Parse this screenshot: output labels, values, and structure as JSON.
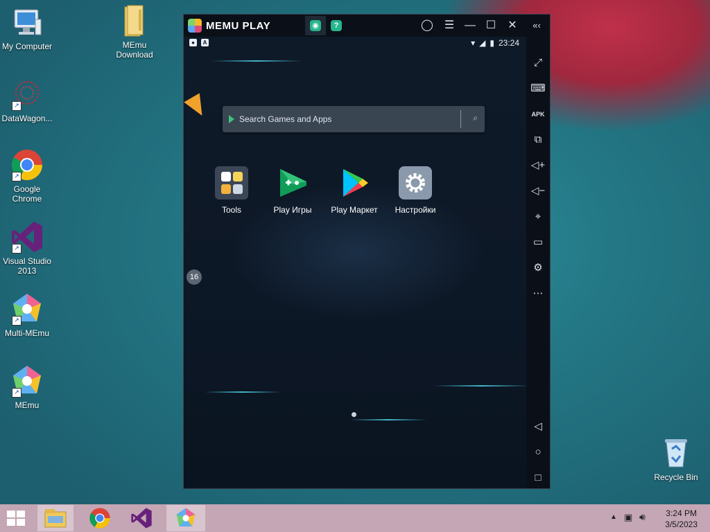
{
  "desktop": {
    "icons": [
      {
        "label": "My Computer",
        "icon": "computer-icon"
      },
      {
        "label": "MEmu\nDownload",
        "icon": "folder-icon"
      },
      {
        "label": "DataWagon...",
        "icon": "datawagon-icon"
      },
      {
        "label": "Google\nChrome",
        "icon": "chrome-icon"
      },
      {
        "label": "Visual Studio\n2013",
        "icon": "visual-studio-icon"
      },
      {
        "label": "Multi-MEmu",
        "icon": "multi-memu-icon"
      },
      {
        "label": "MEmu",
        "icon": "memu-icon"
      },
      {
        "label": "Recycle Bin",
        "icon": "recycle-bin-icon"
      }
    ]
  },
  "emulator": {
    "brand": "MEMU PLAY",
    "status": {
      "time": "23:24"
    },
    "search": {
      "placeholder": "Search Games and Apps"
    },
    "apps": [
      {
        "label": "Tools"
      },
      {
        "label": "Play Игры"
      },
      {
        "label": "Play Маркет"
      },
      {
        "label": "Настройки"
      }
    ],
    "floating_badge": "16",
    "sidebar_tools": [
      "fullscreen-icon",
      "keyboard-icon",
      "apk-icon",
      "multi-window-icon",
      "volume-up-icon",
      "volume-down-icon",
      "location-icon",
      "folder-icon",
      "settings-icon",
      "more-icon"
    ],
    "nav": [
      "back-icon",
      "home-icon",
      "recents-icon"
    ]
  },
  "taskbar": {
    "clock_time": "3:24 PM",
    "clock_date": "3/5/2023"
  },
  "colors": {
    "desktop": "#237684",
    "taskbar": "#c4a6b4",
    "emulator_bg": "#0d1520",
    "accent_green": "#26b58c"
  }
}
